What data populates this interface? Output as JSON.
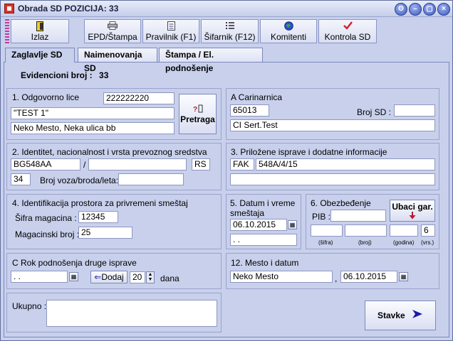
{
  "window": {
    "title": "Obrada SD   POZICIJA: 33",
    "controls": [
      "ʘ",
      "–",
      "▢",
      "×"
    ]
  },
  "toolbar": {
    "buttons": [
      {
        "label": "Izlaz",
        "icon": "exit-icon"
      },
      {
        "label": "EPD/Štampa",
        "icon": "printer-icon"
      },
      {
        "label": "Pravilnik (F1)",
        "icon": "document-icon"
      },
      {
        "label": "Šifarnik (F12)",
        "icon": "list-icon"
      },
      {
        "label": "Komitenti",
        "icon": "globe-icon"
      },
      {
        "label": "Kontrola SD",
        "icon": "checkmark-icon"
      }
    ]
  },
  "tabs": [
    {
      "label": "Zaglavlje SD",
      "active": true
    },
    {
      "label": "Naimenovanja SD",
      "active": false
    },
    {
      "label": "Štampa / El. podnošenje",
      "active": false
    }
  ],
  "evidencija": {
    "label": "Evidencioni broj :",
    "value": "33"
  },
  "odgovorno_lice": {
    "title": "1. Odgovorno lice",
    "id": "222222220",
    "name": "\"TEST 1\"",
    "address": "Neko Mesto, Neka ulica bb",
    "search_button": "Pretraga"
  },
  "carinarnica": {
    "title": "A Carinarnica",
    "code": "65013",
    "sd_label": "Broj SD :",
    "sd_value": "",
    "name": "CI Sert.Test"
  },
  "prevozno_sredstvo": {
    "title": "2. Identitet, nacionalnost i vrsta prevoznog sredstva",
    "plate": "BG548AA",
    "separator": "/",
    "plate2": "",
    "country": "RS",
    "type": "34",
    "voyage_label": "Broj voza/broda/leta:",
    "voyage_value": ""
  },
  "isprave": {
    "title": "3. Priložene isprave i dodatne informacije",
    "code": "FAK",
    "number": "548A/4/15",
    "info": ""
  },
  "prostor": {
    "title": "4. Identifikacija prostora za privremeni smeštaj",
    "warehouse_code_label": "Šifra magacina :",
    "warehouse_code": "12345",
    "warehouse_number_label": "Magacinski broj :",
    "warehouse_number": "25"
  },
  "datum_smestaja": {
    "title": "5. Datum i vreme smeštaja",
    "date": "06.10.2015",
    "time": "  .  ."
  },
  "obezbedjenje": {
    "title": "6. Obezbeđenje",
    "pib_label": "PIB :",
    "pib_value": "",
    "insert_button": "Ubaci gar.",
    "sifra": "",
    "broj": "",
    "godina": "",
    "vrsta": "6",
    "col_sifra": "(šifra)",
    "col_broj": "(broj)",
    "col_godina": "(godina)",
    "col_vrsta": "(vrs.)"
  },
  "rok": {
    "title": "C Rok podnošenja druge isprave",
    "date": "  .  .",
    "add_button": "Dodaj",
    "days": "20",
    "days_label": "dana"
  },
  "mesto_datum": {
    "title": "12. Mesto i datum",
    "place": "Neko Mesto",
    "comma": ",",
    "date": "06.10.2015"
  },
  "ukupno": {
    "label": "Ukupno :",
    "value": ""
  },
  "stavke_button": "Stavke",
  "colors": {
    "window_bg": "#c8d0ec",
    "accent": "#1a1aa8",
    "danger": "#c0142a"
  }
}
